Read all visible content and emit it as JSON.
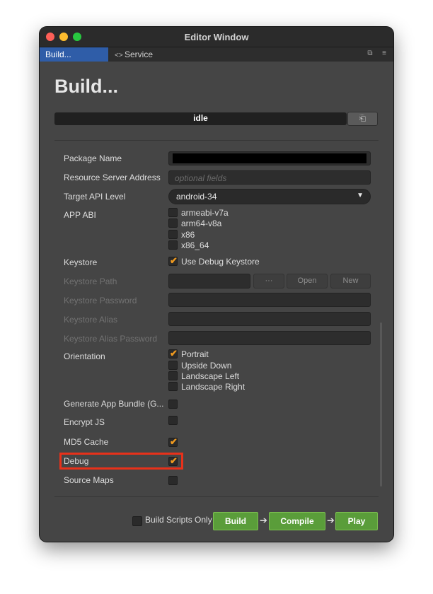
{
  "window": {
    "title": "Editor Window"
  },
  "tabs": [
    {
      "label": "Build..."
    },
    {
      "label": "Service",
      "icon": "link-icon"
    }
  ],
  "tab_icons": [
    "maximize-icon",
    "menu-icon"
  ],
  "header": {
    "title": "Build..."
  },
  "progress": {
    "status": "idle",
    "doc_icon": "document-icon"
  },
  "form": {
    "package_name": {
      "label": "Package Name",
      "value": ""
    },
    "resource_server": {
      "label": "Resource Server Address",
      "placeholder": "optional fields"
    },
    "target_api": {
      "label": "Target API Level",
      "value": "android-34"
    },
    "app_abi": {
      "label": "APP ABI",
      "options": [
        {
          "label": "armeabi-v7a",
          "checked": false
        },
        {
          "label": "arm64-v8a",
          "checked": false
        },
        {
          "label": "x86",
          "checked": false
        },
        {
          "label": "x86_64",
          "checked": false
        }
      ]
    },
    "keystore": {
      "label": "Keystore",
      "use_debug": "Use Debug Keystore",
      "use_debug_checked": true
    },
    "keystore_path": {
      "label": "Keystore Path",
      "browse": "···",
      "open": "Open",
      "new": "New"
    },
    "keystore_password": {
      "label": "Keystore Password"
    },
    "keystore_alias": {
      "label": "Keystore Alias"
    },
    "keystore_alias_password": {
      "label": "Keystore Alias Password"
    },
    "orientation": {
      "label": "Orientation",
      "options": [
        {
          "label": "Portrait",
          "checked": true
        },
        {
          "label": "Upside Down",
          "checked": false
        },
        {
          "label": "Landscape Left",
          "checked": false
        },
        {
          "label": "Landscape Right",
          "checked": false
        }
      ]
    },
    "generate_app_bundle": {
      "label": "Generate App Bundle (G...",
      "checked": false
    },
    "encrypt_js": {
      "label": "Encrypt JS",
      "checked": false
    },
    "md5_cache": {
      "label": "MD5 Cache",
      "checked": true
    },
    "debug": {
      "label": "Debug",
      "checked": true
    },
    "source_maps": {
      "label": "Source Maps",
      "checked": false
    }
  },
  "footer": {
    "build_scripts_only": {
      "label": "Build Scripts Only",
      "checked": false
    },
    "build": "Build",
    "compile": "Compile",
    "play": "Play"
  },
  "colors": {
    "accent": "#f09a1f",
    "highlight": "#e8311a",
    "action": "#5a9d3a",
    "tab_active": "#2f5da8"
  }
}
